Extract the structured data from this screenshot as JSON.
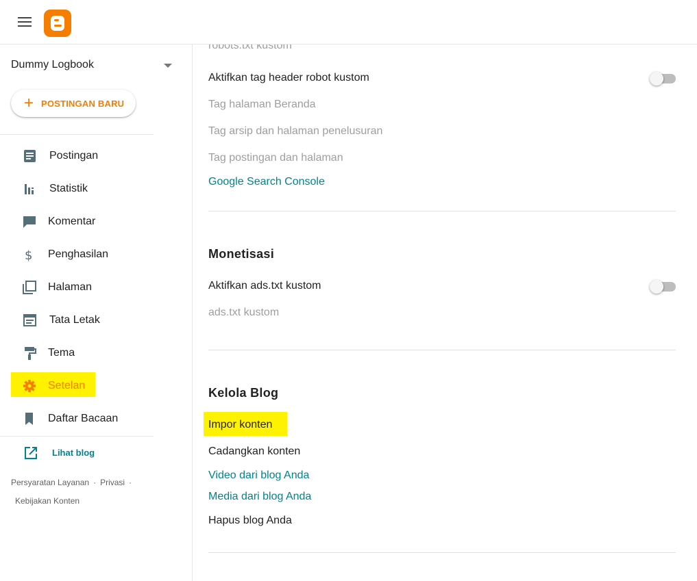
{
  "header": {
    "menu_icon": "hamburger-icon",
    "logo_icon": "blogger-logo",
    "brand_color": "#f57d00"
  },
  "sidebar": {
    "blog_name": "Dummy Logbook",
    "new_post_label": "POSTINGAN BARU",
    "items": [
      {
        "label": "Postingan",
        "icon": "posts-icon"
      },
      {
        "label": "Statistik",
        "icon": "stats-icon"
      },
      {
        "label": "Komentar",
        "icon": "comment-icon"
      },
      {
        "label": "Penghasilan",
        "icon": "dollar-icon"
      },
      {
        "label": "Halaman",
        "icon": "pages-icon"
      },
      {
        "label": "Tata Letak",
        "icon": "layout-icon"
      },
      {
        "label": "Tema",
        "icon": "paint-roller-icon"
      },
      {
        "label": "Setelan",
        "icon": "gear-icon",
        "active": true
      },
      {
        "label": "Daftar Bacaan",
        "icon": "bookmark-icon"
      }
    ],
    "view_blog_label": "Lihat blog",
    "footer": {
      "terms": "Persyaratan Layanan",
      "privacy": "Privasi",
      "content_policy": "Kebijakan Konten",
      "separator": "·"
    }
  },
  "main": {
    "crawlers": {
      "robots_txt_label": "robots.txt kustom",
      "header_tags_label": "Aktifkan tag header robot kustom",
      "header_tags_enabled": false,
      "home_tags_label": "Tag halaman Beranda",
      "archive_tags_label": "Tag arsip dan halaman penelusuran",
      "post_tags_label": "Tag postingan dan halaman",
      "search_console_label": "Google Search Console"
    },
    "monetization": {
      "title": "Monetisasi",
      "ads_txt_toggle_label": "Aktifkan ads.txt kustom",
      "ads_txt_enabled": false,
      "ads_txt_label": "ads.txt kustom"
    },
    "manage": {
      "title": "Kelola Blog",
      "import_label": "Impor konten",
      "backup_label": "Cadangkan konten",
      "videos_label": "Video dari blog Anda",
      "media_label": "Media dari blog Anda",
      "delete_label": "Hapus blog Anda"
    }
  },
  "colors": {
    "accent": "#f57d00",
    "link": "#00838f",
    "highlight": "#fff200",
    "muted_text": "#9e9e9e"
  }
}
